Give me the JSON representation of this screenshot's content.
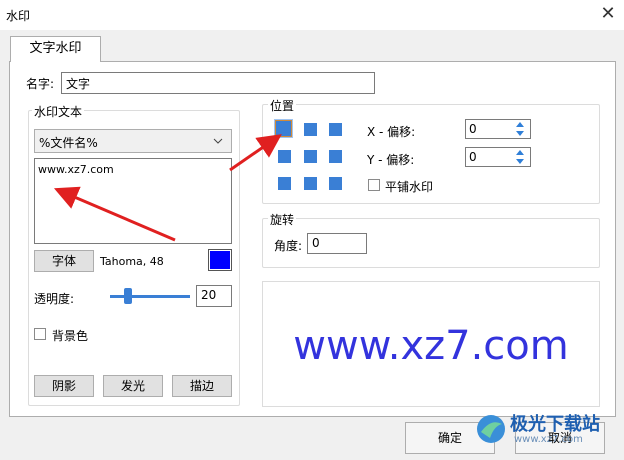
{
  "window": {
    "title": "水印",
    "close_glyph": "✕"
  },
  "tabs": [
    {
      "label": "文字水印"
    }
  ],
  "name_field": {
    "label": "名字:",
    "value": "文字"
  },
  "watermark_text": {
    "group_label": "水印文本",
    "dropdown_value": "%文件名%",
    "text_value": "www.xz7.com",
    "font_button": "字体",
    "font_desc": "Tahoma, 48",
    "color": "#0000ff",
    "opacity_label": "透明度:",
    "opacity_value": "20",
    "bg_checkbox_label": "背景色",
    "bg_checked": false,
    "buttons": {
      "shadow": "阴影",
      "glow": "发光",
      "stroke": "描边"
    }
  },
  "position": {
    "group_label": "位置",
    "selected_cell": "top-left",
    "x_offset_label": "X - 偏移:",
    "x_offset_value": "0",
    "y_offset_label": "Y - 偏移:",
    "y_offset_value": "0",
    "tile_label": "平铺水印",
    "tile_checked": false
  },
  "rotation": {
    "group_label": "旋转",
    "angle_label": "角度:",
    "angle_value": "0"
  },
  "preview": {
    "text": "www.xz7.com",
    "color": "#3333dd"
  },
  "footer": {
    "ok_label": "确定",
    "cancel_label": "取消"
  },
  "watermark_logo": {
    "text": "极光下载站",
    "url": "www.xz7.com"
  }
}
